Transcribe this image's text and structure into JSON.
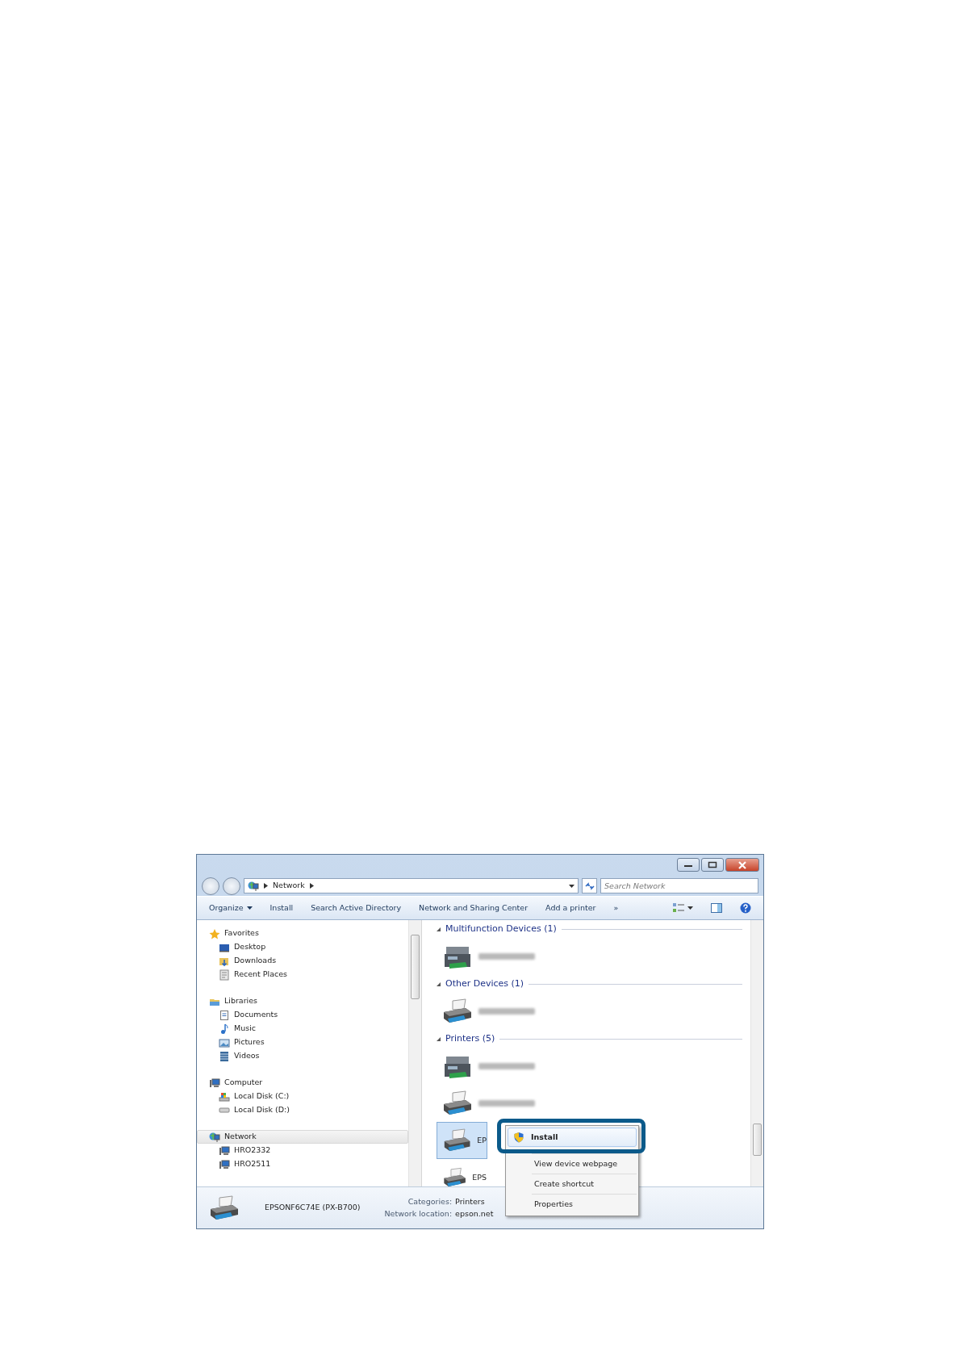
{
  "address_bar": {
    "breadcrumb": [
      "Network"
    ],
    "search": {
      "placeholder": "Search Network"
    }
  },
  "toolbar": [
    {
      "label": "Organize",
      "kind": "dropdown"
    },
    {
      "label": "Install",
      "kind": "button"
    },
    {
      "label": "Search Active Directory",
      "kind": "button"
    },
    {
      "label": "Network and Sharing Center",
      "kind": "button"
    },
    {
      "label": "Add a printer",
      "kind": "button"
    },
    {
      "label": "»",
      "kind": "button"
    }
  ],
  "navigation": [
    {
      "label": "Favorites",
      "selected": false,
      "children": [
        {
          "label": "Desktop",
          "selected": false
        },
        {
          "label": "Downloads",
          "selected": false
        },
        {
          "label": "Recent Places",
          "selected": false
        }
      ]
    },
    {
      "label": "Libraries",
      "selected": false,
      "children": [
        {
          "label": "Documents",
          "selected": false
        },
        {
          "label": "Music",
          "selected": false
        },
        {
          "label": "Pictures",
          "selected": false
        },
        {
          "label": "Videos",
          "selected": false
        }
      ]
    },
    {
      "label": "Computer",
      "selected": false,
      "children": [
        {
          "label": "Local Disk (C:)",
          "selected": false
        },
        {
          "label": "Local Disk (D:)",
          "selected": false
        }
      ]
    },
    {
      "label": "Network",
      "selected": true,
      "children": [
        {
          "label": "HRO2332",
          "selected": false
        },
        {
          "label": "HRO2511",
          "selected": false
        }
      ]
    }
  ],
  "groups": [
    {
      "title": "Multifunction Devices (1)",
      "items": [
        {
          "kind": "multifunction",
          "selected": false
        }
      ]
    },
    {
      "title": "Other Devices (1)",
      "items": [
        {
          "kind": "printer",
          "selected": false
        }
      ]
    },
    {
      "title": "Printers (5)",
      "items": [
        {
          "kind": "multifunction",
          "selected": false
        },
        {
          "kind": "printer",
          "selected": false
        },
        {
          "kind": "printer",
          "selected": true,
          "label": "EP"
        },
        {
          "kind": "printer",
          "selected": false,
          "label": "EPS"
        }
      ]
    }
  ],
  "context_menu": [
    {
      "label": "Install",
      "default": true,
      "highlighted": true
    },
    {
      "label": "View device webpage",
      "default": false,
      "highlighted": false
    },
    {
      "label": "Create shortcut",
      "default": false,
      "highlighted": false
    },
    {
      "label": "Properties",
      "default": false,
      "highlighted": false
    }
  ],
  "details": {
    "name": "EPSONF6C74E (PX-B700)",
    "fields": [
      {
        "label": "Categories:",
        "value": "Printers"
      },
      {
        "label": "Network location:",
        "value": "epson.net"
      }
    ]
  }
}
